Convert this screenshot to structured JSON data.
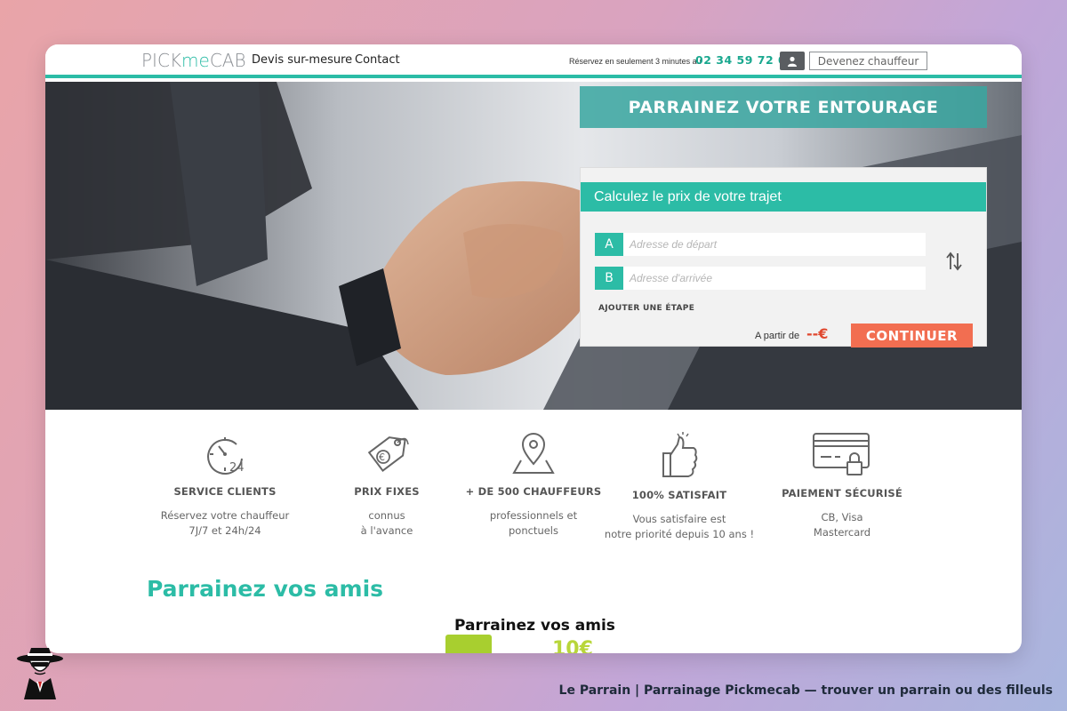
{
  "header": {
    "logo_pick": "PICK",
    "logo_me": "me",
    "logo_cab": "CAB",
    "nav": [
      "Devis sur-mesure",
      "Contact"
    ],
    "promo_text": "Réservez en seulement 3 minutes au",
    "phone": "02 34 59 72 00",
    "driver_button": "Devenez chauffeur"
  },
  "hero": {
    "banner": "PARRAINEZ VOTRE ENTOURAGE",
    "calculator": {
      "title": "Calculez le prix de votre trajet",
      "start_letter": "A",
      "start_placeholder": "Adresse de départ",
      "end_letter": "B",
      "end_placeholder": "Adresse d'arrivée",
      "add_step": "AJOUTER UNE ÉTAPE",
      "price_label": "A partir de",
      "price_value": "--€",
      "continue": "CONTINUER"
    }
  },
  "features": [
    {
      "title": "SERVICE CLIENTS",
      "line1": "Réservez votre chauffeur",
      "line2": "7J/7 et 24h/24"
    },
    {
      "title": "PRIX FIXES",
      "line1": "connus",
      "line2": "à l'avance"
    },
    {
      "title": "+ DE 500 CHAUFFEURS",
      "line1": "professionnels et",
      "line2": "ponctuels"
    },
    {
      "title": "100% SATISFAIT",
      "line1": "Vous satisfaire est",
      "line2": "notre priorité depuis 10 ans !"
    },
    {
      "title": "PAIEMENT SÉCURISÉ",
      "line1": "CB, Visa",
      "line2": "Mastercard"
    }
  ],
  "friends": {
    "title": "Parrainez vos amis",
    "image_title": "Parrainez vos amis",
    "image_amount": "10€"
  },
  "caption": "Le Parrain | Parrainage Pickmecab — trouver un parrain ou des filleuls",
  "colors": {
    "accent": "#2cbca6",
    "cta": "#f26e51",
    "price": "#e0482f"
  }
}
